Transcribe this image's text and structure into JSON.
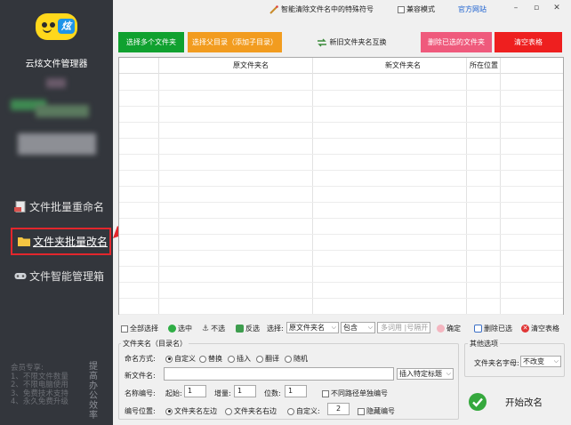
{
  "app": {
    "title": "云炫文件管理器"
  },
  "sidebar": {
    "items": [
      {
        "label": "文件批量重命名",
        "icon": "document-icon"
      },
      {
        "label": "文件夹批量改名",
        "icon": "folder-icon"
      },
      {
        "label": "文件智能管理箱",
        "icon": "gamepad-icon"
      }
    ],
    "promo_lines": [
      "会员专享:",
      "1、不限文件数量",
      "2、不限电脑使用",
      "3、免费技术支持",
      "4、永久免费升级"
    ],
    "promo_side": "提高办公效率"
  },
  "topbar": {
    "clear_special": "智能清除文件名中的特殊符号",
    "compat_mode": "兼容模式",
    "official_site": "官方网站",
    "min": "–",
    "max": "▫",
    "close": "✕"
  },
  "actions": {
    "select_folders": "选择多个文件夹",
    "select_subdirs": "选择父目录（添加子目录）",
    "swap_names": "新旧文件夹名互换",
    "delete_selected": "删除已选的文件夹",
    "clear_table": "清空表格"
  },
  "table": {
    "columns": [
      "原文件夹名",
      "新文件夹名",
      "所在位置"
    ],
    "rows": []
  },
  "toolbar2": {
    "select_all": "全部选择",
    "select": "选中",
    "unselect": "不选",
    "invert": "反选",
    "choose_label": "选择:",
    "field_select": "原文件夹名",
    "match_select": "包含",
    "keyword_placeholder": "多词用 |号隔开",
    "confirm": "确定",
    "delete_selected": "删除已选",
    "clear_table": "清空表格"
  },
  "rename": {
    "group_title": "文件夹名（目录名）",
    "mode_label": "命名方式:",
    "modes": [
      "自定义",
      "替换",
      "插入",
      "翻译",
      "随机"
    ],
    "newname_label": "新文件名:",
    "newname_value": "",
    "insert_tag": "插入特定标题",
    "number_label": "名称编号:",
    "start_label": "起始:",
    "start_value": "1",
    "step_label": "增量:",
    "step_value": "1",
    "digits_label": "位数:",
    "digits_value": "1",
    "separate_paths": "不同路径单独编号",
    "position_label": "编号位置:",
    "positions": [
      "文件夹名左边",
      "文件夹名右边",
      "自定义:"
    ],
    "custom_pos": "2",
    "hide_number": "隐藏编号"
  },
  "other": {
    "group_title": "其他选项",
    "case_label": "文件夹名字母:",
    "case_value": "不改变",
    "start_button": "开始改名"
  },
  "colors": {
    "sidebar_bg": "#33363c",
    "green": "#10a12f",
    "orange": "#f29c1f",
    "pink": "#ef5a7c",
    "red": "#ee1f1f",
    "link_blue": "#1a5fcf",
    "highlight_red": "#e3262c"
  }
}
